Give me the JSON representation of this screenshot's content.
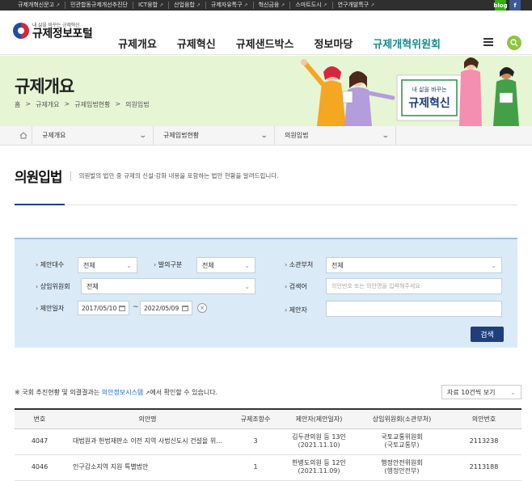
{
  "topbar": {
    "links": [
      {
        "label": "규제개혁신문고",
        "ext": true
      },
      {
        "label": "민관합동규제개선추진단",
        "ext": false
      },
      {
        "label": "ICT융합",
        "ext": true
      },
      {
        "label": "산업융합",
        "ext": true
      },
      {
        "label": "규제자유특구",
        "ext": true
      },
      {
        "label": "혁신금융",
        "ext": true
      },
      {
        "label": "스마트도시",
        "ext": true
      },
      {
        "label": "연구개발특구",
        "ext": true
      }
    ],
    "social": [
      "blog",
      "f"
    ]
  },
  "logo": {
    "slogan": "내 삶을 바꾸는 규제혁신",
    "name": "규제정보포털"
  },
  "gnb": [
    "규제개요",
    "규제혁신",
    "규제샌드박스",
    "정보마당",
    "규제개혁위원회"
  ],
  "hero": {
    "title": "규제개요",
    "breadcrumb": [
      "홈",
      "규제개요",
      "규제입법현황",
      "의원입법"
    ],
    "banner_line1": "내 삶을 바꾸는",
    "banner_line2": "규제혁신"
  },
  "subnav": [
    "규제개요",
    "규제입법현황",
    "의원입법"
  ],
  "page": {
    "title": "의원입법",
    "desc": "의원발의 법안 중 규제의 신설·강화 내용을 포함하는 법안 현황을 알려드립니다."
  },
  "filter": {
    "labels": {
      "daesu": "제안대수",
      "gubun": "발의구분",
      "dept": "소관부처",
      "committee": "상임위원회",
      "keyword": "검색어",
      "date": "제안일자",
      "proposer": "제안자"
    },
    "values": {
      "daesu": "전체",
      "gubun": "전체",
      "dept": "전체",
      "committee": "전체",
      "keyword_placeholder": "의안번호 또는 의안명을 입력해주세요",
      "date_from": "2017/05/10",
      "date_to": "2022/05/09",
      "proposer": ""
    },
    "tilde": "~",
    "clear": "×",
    "search_btn": "검색"
  },
  "notice": {
    "prefix": "※ 국회 추진현황 및 의결결과는 ",
    "link": "의안정보시스템",
    "suffix": "에서 확인할 수 있습니다."
  },
  "perpage": "자료 10건씩 보기",
  "table": {
    "headers": [
      "번호",
      "의안명",
      "규제조항수",
      "제안자(제안일자)",
      "상임위원회(소관부처)",
      "의안번호"
    ],
    "rows": [
      {
        "no": "4047",
        "title": "대법원과 헌법재판소 이전 지역 사법신도시 건설을 위...",
        "count": "3",
        "proposer": "김두관의원 등 13인",
        "date": "(2021.11.10)",
        "committee": "국토교통위원회",
        "dept": "(국토교통부)",
        "bill": "2113238"
      },
      {
        "no": "4046",
        "title": "인구감소지역 지원 특별법안",
        "count": "1",
        "proposer": "한병도의원 등 12인",
        "date": "(2021.11.09)",
        "committee": "행정안전위원회",
        "dept": "(행정안전부)",
        "bill": "2113188"
      }
    ]
  },
  "colors": {
    "accent_green": "#8cc63f",
    "nav_active": "#168e8c",
    "navy": "#1d3f7a",
    "hero_bg": "#e6f5d4",
    "filter_bg": "#dbeaf7"
  }
}
